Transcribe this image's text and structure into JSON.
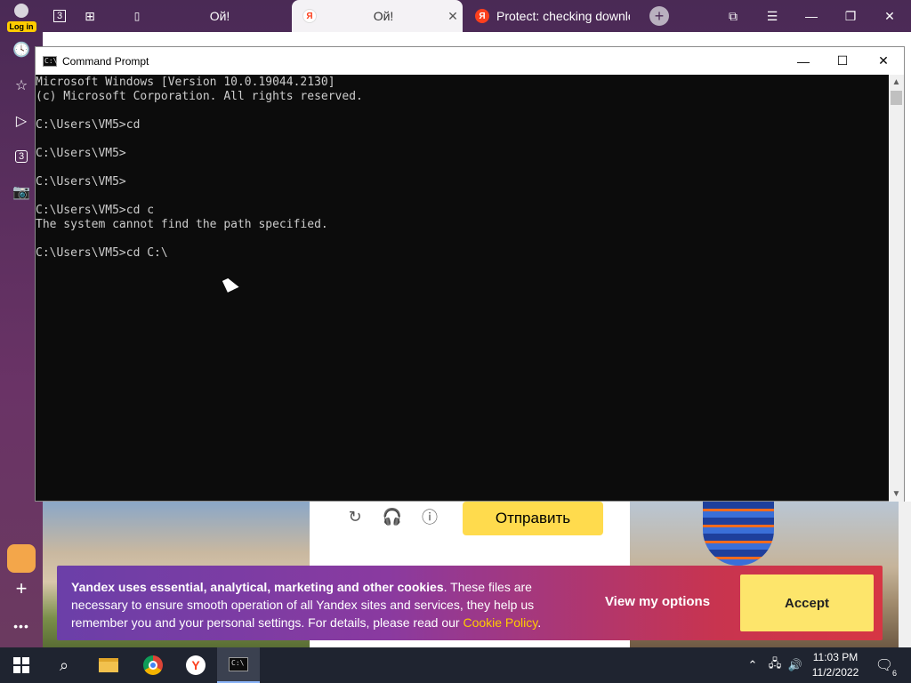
{
  "browser": {
    "login_label": "Log in",
    "tab_count_badge": "3",
    "rail_tab_count": "3",
    "tabs": [
      {
        "title": "Ой!",
        "active": false
      },
      {
        "title": "Ой!",
        "active": true
      },
      {
        "title": "Protect: checking downlo",
        "active": false
      }
    ],
    "new_tab_symbol": "+"
  },
  "page": {
    "send_button": "Отправить",
    "cookie": {
      "bold_text": "Yandex uses essential, analytical, marketing and other cookies",
      "body_text": ". These files are necessary to ensure smooth operation of all Yandex sites and services, they help us remember you and your personal settings. For details, please read our ",
      "link_text": "Cookie Policy",
      "end_text": ".",
      "view_options": "View my options",
      "accept": "Accept"
    }
  },
  "cmd": {
    "title": "Command Prompt",
    "lines": [
      "Microsoft Windows [Version 10.0.19044.2130]",
      "(c) Microsoft Corporation. All rights reserved.",
      "",
      "C:\\Users\\VM5>cd",
      "",
      "C:\\Users\\VM5>",
      "",
      "C:\\Users\\VM5>",
      "",
      "C:\\Users\\VM5>cd c",
      "The system cannot find the path specified.",
      "",
      "C:\\Users\\VM5>cd C:\\"
    ]
  },
  "taskbar": {
    "time": "11:03 PM",
    "date": "11/2/2022",
    "notification_count": "6",
    "items": [
      "start-icon",
      "search-icon",
      "file-explorer-icon",
      "chrome-icon",
      "yandex-browser-icon",
      "command-prompt-icon"
    ]
  },
  "colors": {
    "cmd_background": "#0c0c0c",
    "cmd_text": "#cccccc",
    "accept_button": "#fde56b",
    "send_button": "#ffdb4d",
    "cookie_link": "#ffcc00",
    "taskbar": "#1f2430"
  }
}
